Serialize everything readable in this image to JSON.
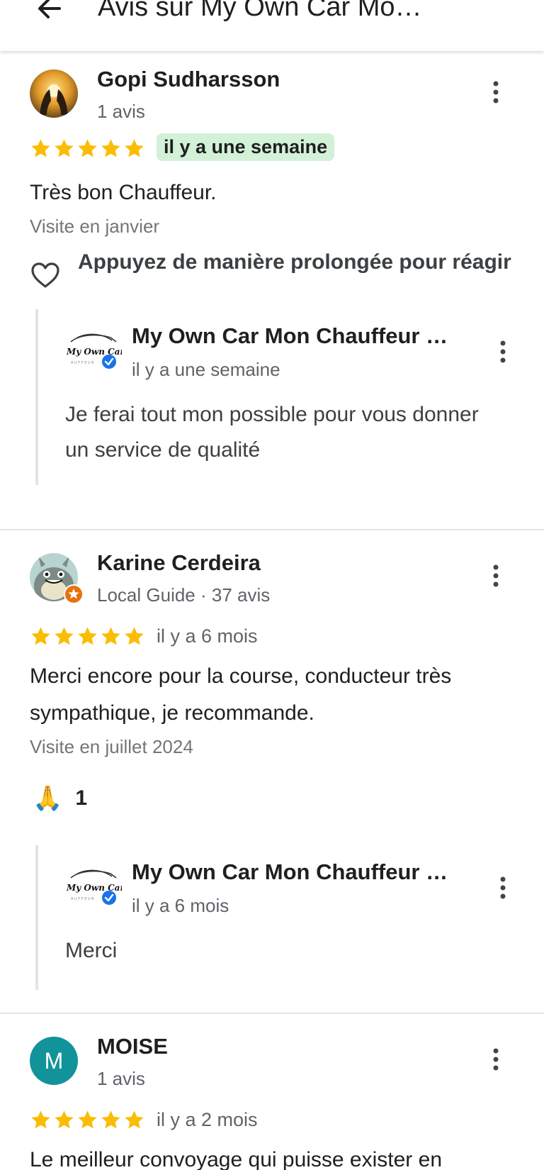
{
  "header": {
    "title": "Avis sur My Own Car Mo…",
    "back_icon": "arrow-left-icon"
  },
  "reviews": [
    {
      "author": "Gopi Sudharsson",
      "meta": "1 avis",
      "rating": 5,
      "time": "il y a une semaine",
      "text": "Très bon Chauffeur.",
      "visit": "Visite en janvier",
      "react_prompt": "Appuyez de manière prolongée pour réagir",
      "owner_reply": {
        "name": "My Own Car Mon Chauffeur …",
        "logo_text": "My Own Car",
        "time": "il y a une semaine",
        "text": "Je ferai tout mon possible pour vous donner un service de qualité"
      }
    },
    {
      "author": "Karine Cerdeira",
      "meta": "Local Guide · 37 avis",
      "rating": 5,
      "time": "il y a 6 mois",
      "text": "Merci encore pour la course, conducteur très sympathique, je recommande.",
      "visit": "Visite en juillet 2024",
      "reaction_emoji": "🙏",
      "reaction_count": "1",
      "owner_reply": {
        "name": "My Own Car Mon Chauffeur …",
        "logo_text": "My Own Car",
        "time": "il y a 6 mois",
        "text": "Merci"
      }
    },
    {
      "author": "MOISE",
      "avatar_letter": "M",
      "meta": "1 avis",
      "rating": 5,
      "time": "il y a 2 mois",
      "text": "Le meilleur convoyage qui puisse exister en"
    }
  ],
  "colors": {
    "star": "#fbbc04",
    "highlight_badge": "#d3f0d9",
    "verified": "#1a73e8",
    "local_guide": "#e8710a",
    "avatar_teal": "#12939a"
  }
}
